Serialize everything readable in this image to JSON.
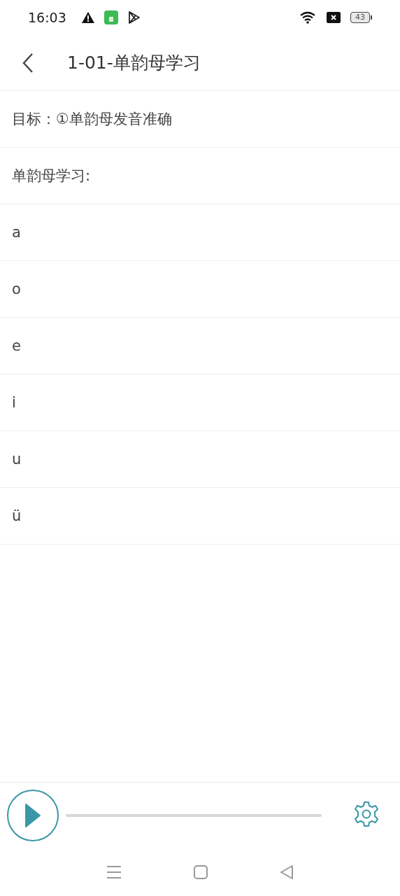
{
  "status_bar": {
    "time": "16:03",
    "battery": "43"
  },
  "header": {
    "title": "1-01-单韵母学习"
  },
  "rows": [
    {
      "text": "目标：①单韵母发音准确"
    },
    {
      "text": "单韵母学习:"
    },
    {
      "text": "a"
    },
    {
      "text": "o"
    },
    {
      "text": "e"
    },
    {
      "text": "i"
    },
    {
      "text": "u"
    },
    {
      "text": "ü"
    }
  ]
}
